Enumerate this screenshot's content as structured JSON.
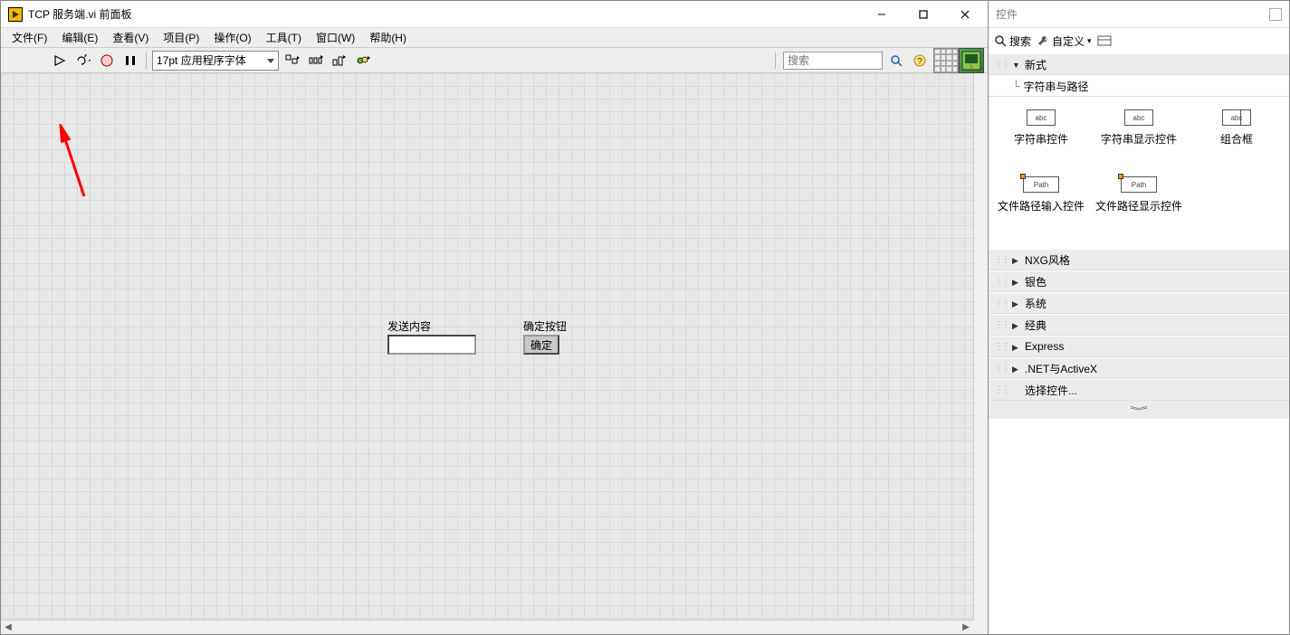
{
  "title": "TCP 服务端.vi 前面板",
  "menu": {
    "file": "文件(F)",
    "edit": "编辑(E)",
    "view": "查看(V)",
    "project": "项目(P)",
    "operate": "操作(O)",
    "tools": "工具(T)",
    "window": "窗口(W)",
    "help": "帮助(H)"
  },
  "toolbar": {
    "font": "17pt 应用程序字体",
    "search_placeholder": "搜索"
  },
  "canvas": {
    "send_label": "发送内容",
    "ok_label": "确定按钮",
    "ok_button": "确定"
  },
  "palette": {
    "title": "控件",
    "search": "搜索",
    "customize": "自定义",
    "tree": {
      "modern": "新式",
      "string_path": "字符串与路径",
      "nxg": "NXG风格",
      "silver": "银色",
      "system": "系统",
      "classic": "经典",
      "express": "Express",
      "dotnet": ".NET与ActiveX",
      "select": "选择控件..."
    },
    "items": {
      "string_ctrl": "字符串控件",
      "string_ind": "字符串显示控件",
      "combo": "组合框",
      "path_in": "文件路径输入控件",
      "path_out": "文件路径显示控件",
      "abc": "abc",
      "path_text": "Path"
    }
  }
}
